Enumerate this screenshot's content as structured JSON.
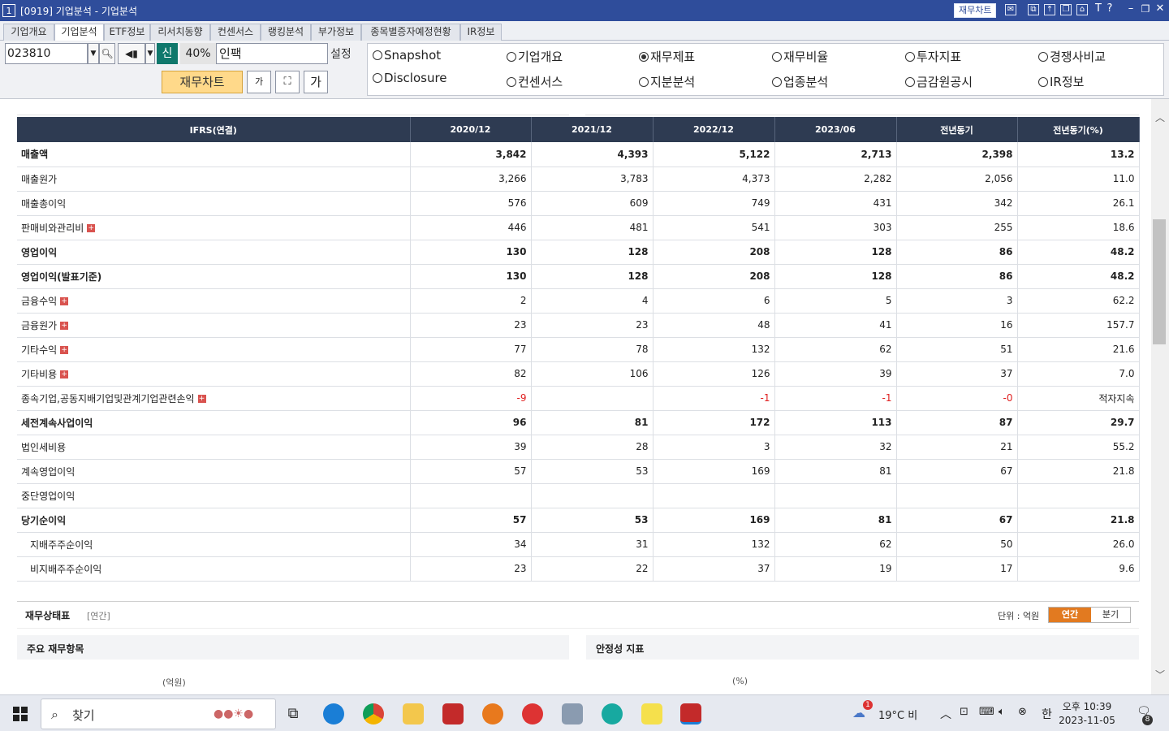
{
  "window": {
    "num": "1",
    "title": "[0919] 기업분석 - 기업분석",
    "chart_btn": "재무차트"
  },
  "tabs": [
    "기업개요",
    "기업분석",
    "ETF정보",
    "리서치동향",
    "컨센서스",
    "랭킹분석",
    "부가정보",
    "종목별증자예정현황",
    "IR정보"
  ],
  "controls": {
    "code": "023810",
    "new_label": "신",
    "percent": "40%",
    "company": "인팩",
    "settings_label": "설정",
    "chart_button": "재무차트",
    "font_small": "가",
    "font_large": "가"
  },
  "radios": [
    {
      "label": "Snapshot",
      "checked": false
    },
    {
      "label": "기업개요",
      "checked": false
    },
    {
      "label": "재무제표",
      "checked": true
    },
    {
      "label": "재무비율",
      "checked": false
    },
    {
      "label": "투자지표",
      "checked": false
    },
    {
      "label": "경쟁사비교",
      "checked": false
    },
    {
      "label": "Disclosure",
      "checked": false
    },
    {
      "label": "컨센서스",
      "checked": false
    },
    {
      "label": "지분분석",
      "checked": false
    },
    {
      "label": "업종분석",
      "checked": false
    },
    {
      "label": "금감원공시",
      "checked": false
    },
    {
      "label": "IR정보",
      "checked": false
    }
  ],
  "table": {
    "headers": [
      "IFRS(연결)",
      "2020/12",
      "2021/12",
      "2022/12",
      "2023/06",
      "전년동기",
      "전년동기(%)"
    ],
    "rows": [
      {
        "label": "매출액",
        "bold": true,
        "values": [
          "3,842",
          "4,393",
          "5,122",
          "2,713",
          "2,398",
          "13.2"
        ]
      },
      {
        "label": "매출원가",
        "values": [
          "3,266",
          "3,783",
          "4,373",
          "2,282",
          "2,056",
          "11.0"
        ]
      },
      {
        "label": "매출총이익",
        "values": [
          "576",
          "609",
          "749",
          "431",
          "342",
          "26.1"
        ]
      },
      {
        "label": "판매비와관리비",
        "plus": true,
        "values": [
          "446",
          "481",
          "541",
          "303",
          "255",
          "18.6"
        ]
      },
      {
        "label": "영업이익",
        "bold": true,
        "values": [
          "130",
          "128",
          "208",
          "128",
          "86",
          "48.2"
        ]
      },
      {
        "label": "영업이익(발표기준)",
        "bold": true,
        "values": [
          "130",
          "128",
          "208",
          "128",
          "86",
          "48.2"
        ]
      },
      {
        "label": "금융수익",
        "plus": true,
        "values": [
          "2",
          "4",
          "6",
          "5",
          "3",
          "62.2"
        ]
      },
      {
        "label": "금융원가",
        "plus": true,
        "values": [
          "23",
          "23",
          "48",
          "41",
          "16",
          "157.7"
        ]
      },
      {
        "label": "기타수익",
        "plus": true,
        "values": [
          "77",
          "78",
          "132",
          "62",
          "51",
          "21.6"
        ]
      },
      {
        "label": "기타비용",
        "plus": true,
        "values": [
          "82",
          "106",
          "126",
          "39",
          "37",
          "7.0"
        ]
      },
      {
        "label": "종속기업,공동지배기업및관계기업관련손익",
        "plus": true,
        "values": [
          "-9",
          "",
          "-1",
          "-1",
          "-0",
          "적자지속"
        ]
      },
      {
        "label": "세전계속사업이익",
        "bold": true,
        "values": [
          "96",
          "81",
          "172",
          "113",
          "87",
          "29.7"
        ]
      },
      {
        "label": "법인세비용",
        "values": [
          "39",
          "28",
          "3",
          "32",
          "21",
          "55.2"
        ]
      },
      {
        "label": "계속영업이익",
        "values": [
          "57",
          "53",
          "169",
          "81",
          "67",
          "21.8"
        ]
      },
      {
        "label": "중단영업이익",
        "values": [
          "",
          "",
          "",
          "",
          "",
          ""
        ]
      },
      {
        "label": "당기순이익",
        "bold": true,
        "values": [
          "57",
          "53",
          "169",
          "81",
          "67",
          "21.8"
        ]
      },
      {
        "label": "지배주주순이익",
        "indent": true,
        "values": [
          "34",
          "31",
          "132",
          "62",
          "50",
          "26.0"
        ]
      },
      {
        "label": "비지배주주순이익",
        "indent": true,
        "values": [
          "23",
          "22",
          "37",
          "19",
          "17",
          "9.6"
        ]
      }
    ]
  },
  "balance": {
    "title": "재무상태표",
    "sub": "[연간]",
    "unit": "단위 : 억원",
    "toggle": [
      "연간",
      "분기"
    ],
    "left_panel": "주요 재무항목",
    "right_panel": "안정성 지표",
    "left_unit": "(억원)",
    "right_unit": "(%)"
  },
  "taskbar": {
    "search": "찾기",
    "weather": "19°C 비",
    "ime": "한",
    "time": "오후 10:39",
    "date": "2023-11-05",
    "noti_count": "8",
    "weather_badge": "1"
  }
}
